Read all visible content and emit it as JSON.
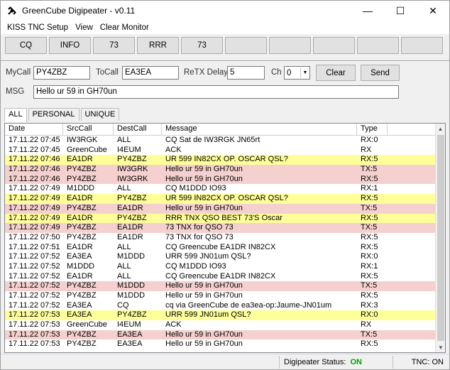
{
  "window": {
    "title": "GreenCube Digipeater - v0.11",
    "minimize": "—",
    "maximize": "☐",
    "close": "✕"
  },
  "menu": [
    "KISS TNC Setup",
    "View",
    "Clear Monitor"
  ],
  "quick_buttons": [
    "CQ",
    "INFO",
    "73",
    "RRR",
    "73",
    "",
    "",
    "",
    "",
    ""
  ],
  "fields": {
    "mycall_label": "MyCall",
    "mycall_value": "PY4ZBZ",
    "tocall_label": "ToCall",
    "tocall_value": "EA3EA",
    "retx_label": "ReTX Delay",
    "retx_value": "5",
    "ch_label": "Ch",
    "ch_value": "0",
    "clear_label": "Clear",
    "send_label": "Send",
    "msg_label": "MSG",
    "msg_value": "Hello ur 59 in GH70un"
  },
  "tabs": [
    "ALL",
    "PERSONAL",
    "UNIQUE"
  ],
  "columns": [
    "Date",
    "SrcCall",
    "DestCall",
    "Message",
    "Type"
  ],
  "rows": [
    {
      "date": "17.11.22 07:45",
      "src": "IW3RGK",
      "dest": "ALL",
      "msg": "CQ Sat de IW3RGK JN65rt",
      "type": "RX:0",
      "hl": ""
    },
    {
      "date": "17.11.22 07:45",
      "src": "GreenCube",
      "dest": "I4EUM",
      "msg": "ACK",
      "type": "RX",
      "hl": ""
    },
    {
      "date": "17.11.22 07:46",
      "src": "EA1DR",
      "dest": "PY4ZBZ",
      "msg": "UR 599 IN82CX  OP. OSCAR QSL?",
      "type": "RX:5",
      "hl": "yellow"
    },
    {
      "date": "17.11.22 07:46",
      "src": "PY4ZBZ",
      "dest": "IW3GRK",
      "msg": "Hello ur 59 in GH70un",
      "type": "TX:5",
      "hl": "pink"
    },
    {
      "date": "17.11.22 07:46",
      "src": "PY4ZBZ",
      "dest": "IW3GRK",
      "msg": "Hello ur 59 in GH70un",
      "type": "RX:5",
      "hl": "pink"
    },
    {
      "date": "17.11.22 07:49",
      "src": "M1DDD",
      "dest": "ALL",
      "msg": "CQ M1DDD IO93",
      "type": "RX:1",
      "hl": ""
    },
    {
      "date": "17.11.22 07:49",
      "src": "EA1DR",
      "dest": "PY4ZBZ",
      "msg": "UR 599 IN82CX  OP. OSCAR QSL?",
      "type": "RX:5",
      "hl": "yellow"
    },
    {
      "date": "17.11.22 07:49",
      "src": "PY4ZBZ",
      "dest": "EA1DR",
      "msg": "Hello ur 59 in GH70un",
      "type": "TX:5",
      "hl": "pink"
    },
    {
      "date": "17.11.22 07:49",
      "src": "EA1DR",
      "dest": "PY4ZBZ",
      "msg": "RRR TNX QSO BEST 73'S Oscar",
      "type": "RX:5",
      "hl": "yellow"
    },
    {
      "date": "17.11.22 07:49",
      "src": "PY4ZBZ",
      "dest": "EA1DR",
      "msg": "73  TNX for QSO  73",
      "type": "TX:5",
      "hl": "pink"
    },
    {
      "date": "17.11.22 07:50",
      "src": "PY4ZBZ",
      "dest": "EA1DR",
      "msg": "73  TNX for QSO  73",
      "type": "RX:5",
      "hl": ""
    },
    {
      "date": "17.11.22 07:51",
      "src": "EA1DR",
      "dest": "ALL",
      "msg": "CQ Greencube EA1DR IN82CX",
      "type": "RX:5",
      "hl": ""
    },
    {
      "date": "17.11.22 07:52",
      "src": "EA3EA",
      "dest": "M1DDD",
      "msg": "URR 599 JN01um QSL?",
      "type": "RX:0",
      "hl": ""
    },
    {
      "date": "17.11.22 07:52",
      "src": "M1DDD",
      "dest": "ALL",
      "msg": "CQ M1DDD IO93",
      "type": "RX:1",
      "hl": ""
    },
    {
      "date": "17.11.22 07:52",
      "src": "EA1DR",
      "dest": "ALL",
      "msg": "CQ Greencube EA1DR IN82CX",
      "type": "RX:5",
      "hl": ""
    },
    {
      "date": "17.11.22 07:52",
      "src": "PY4ZBZ",
      "dest": "M1DDD",
      "msg": "Hello ur 59 in GH70un",
      "type": "TX:5",
      "hl": "pink"
    },
    {
      "date": "17.11.22 07:52",
      "src": "PY4ZBZ",
      "dest": "M1DDD",
      "msg": "Hello ur 59 in GH70un",
      "type": "RX:5",
      "hl": ""
    },
    {
      "date": "17.11.22 07:52",
      "src": "EA3EA",
      "dest": "CQ",
      "msg": "cq via GreenCube de ea3ea-op:Jaume-JN01um",
      "type": "RX:3",
      "hl": ""
    },
    {
      "date": "17.11.22 07:53",
      "src": "EA3EA",
      "dest": "PY4ZBZ",
      "msg": "URR 599 JN01um QSL?",
      "type": "RX:0",
      "hl": "yellow"
    },
    {
      "date": "17.11.22 07:53",
      "src": "GreenCube",
      "dest": "I4EUM",
      "msg": "ACK",
      "type": "RX",
      "hl": ""
    },
    {
      "date": "17.11.22 07:53",
      "src": "PY4ZBZ",
      "dest": "EA3EA",
      "msg": "Hello ur 59 in GH70un",
      "type": "TX:5",
      "hl": "pink"
    },
    {
      "date": "17.11.22 07:53",
      "src": "PY4ZBZ",
      "dest": "EA3EA",
      "msg": "Hello ur 59 in GH70un",
      "type": "RX:5",
      "hl": ""
    }
  ],
  "status": {
    "digipeater_label": "Digipeater Status:",
    "digipeater_value": "ON",
    "tnc": "TNC: ON"
  }
}
